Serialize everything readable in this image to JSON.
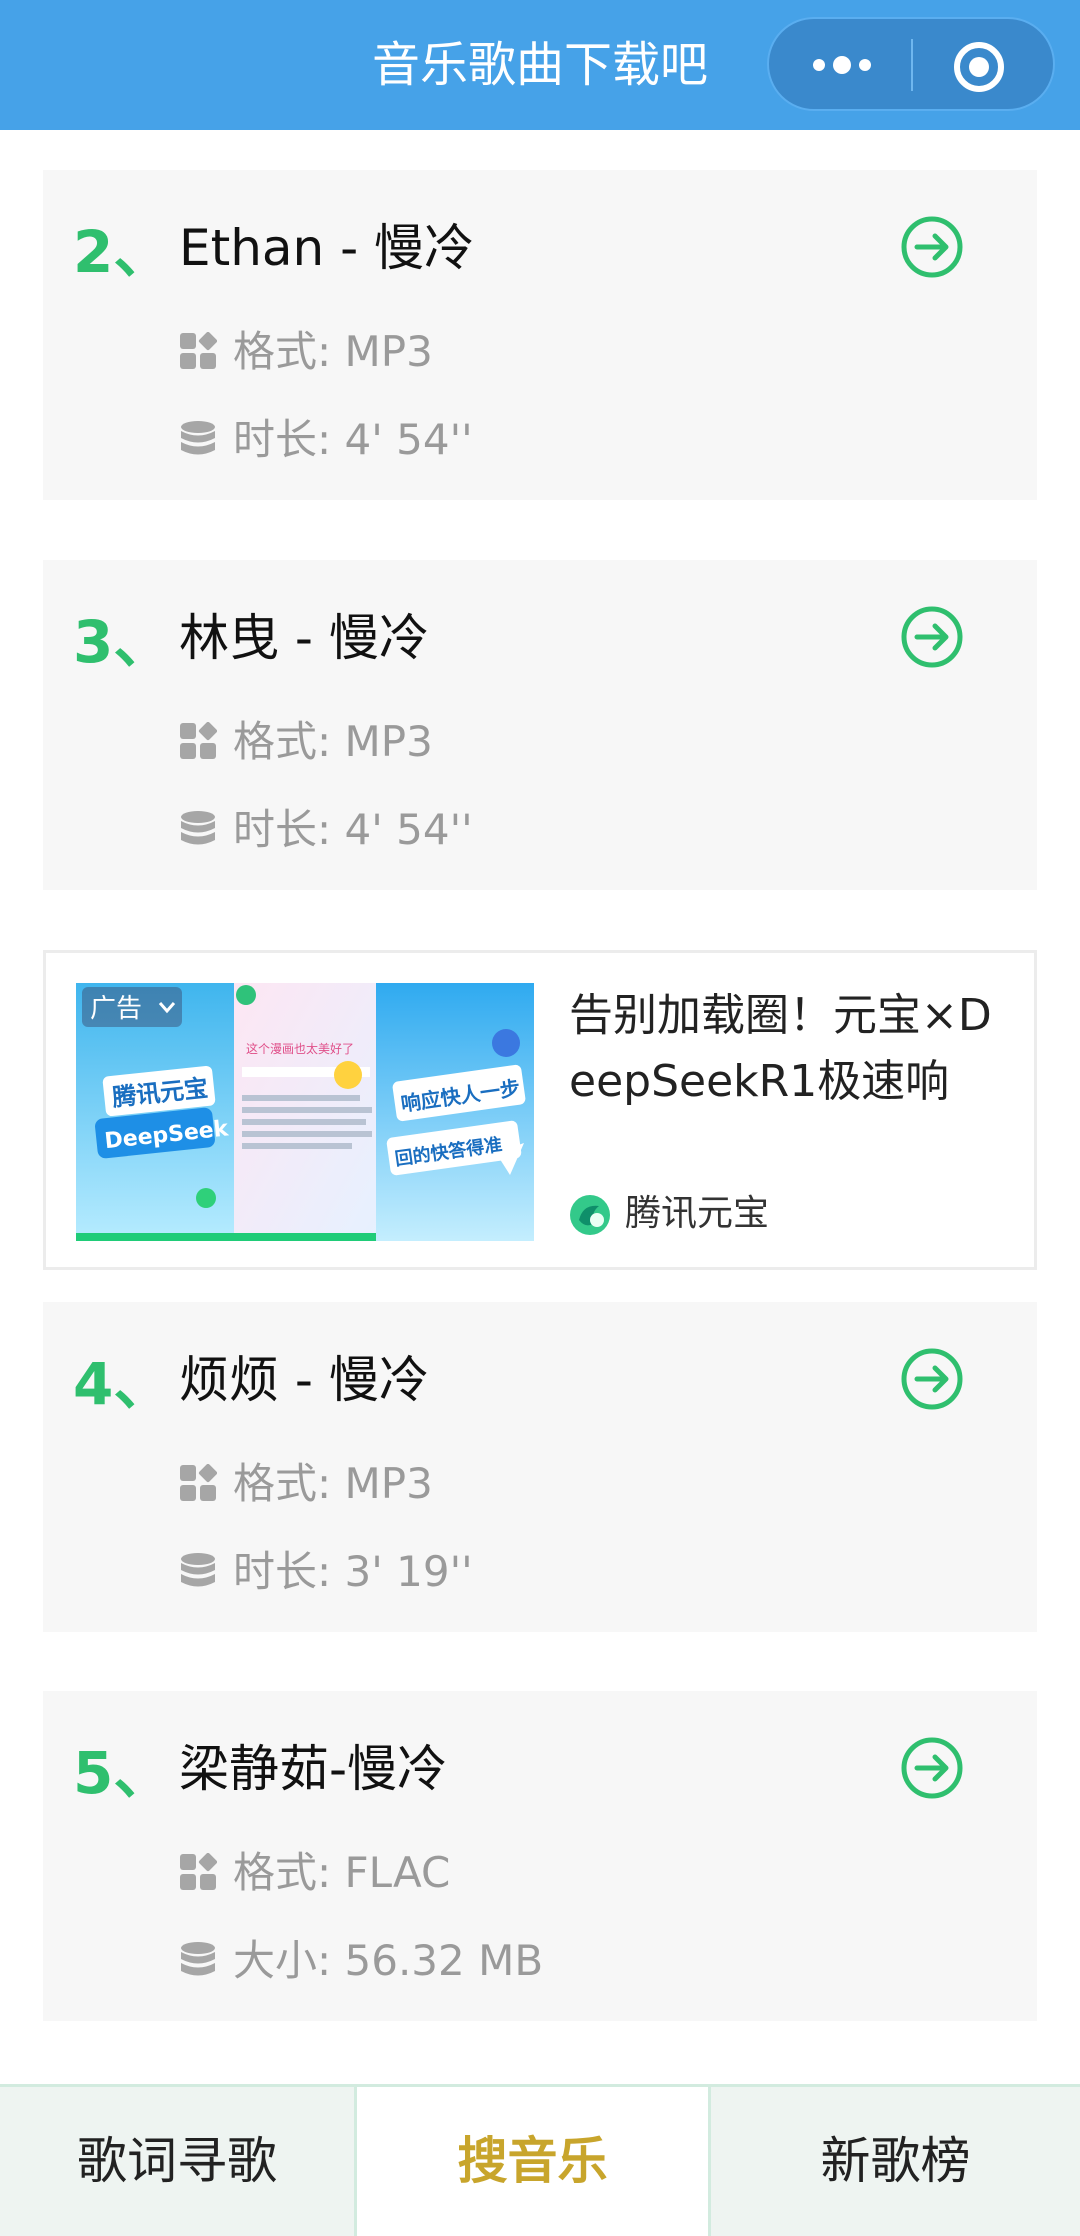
{
  "header": {
    "title": "音乐歌曲下载吧",
    "more_icon": "more-dots-icon",
    "close_icon": "target-close-icon",
    "background": "#46a2e8"
  },
  "songs": [
    {
      "number": "2、",
      "title": "Ethan - 慢冷",
      "format": "格式: MP3",
      "info": "时长: 4' 54''",
      "format_icon": "apps-grid-icon",
      "info_icon": "database-icon",
      "action_icon": "arrow-circle-right-icon"
    },
    {
      "number": "3、",
      "title": "林曳 - 慢冷",
      "format": "格式: MP3",
      "info": "时长: 4' 54''",
      "format_icon": "apps-grid-icon",
      "info_icon": "database-icon",
      "action_icon": "arrow-circle-right-icon"
    },
    {
      "number": "4、",
      "title": "烦烦 - 慢冷",
      "format": "格式: MP3",
      "info": "时长: 3' 19''",
      "format_icon": "apps-grid-icon",
      "info_icon": "database-icon",
      "action_icon": "arrow-circle-right-icon"
    },
    {
      "number": "5、",
      "title": "梁静茹-慢冷",
      "format": "格式: FLAC",
      "info": "大小: 56.32 MB",
      "format_icon": "apps-grid-icon",
      "info_icon": "database-icon",
      "action_icon": "arrow-circle-right-icon"
    }
  ],
  "ad": {
    "badge": "广告",
    "title": "告别加载圈！元宝×DeepSeekR1极速响",
    "brand": "腾讯元宝",
    "image_texts": {
      "left_top": "腾讯元宝",
      "left_bottom": "DeepSeek",
      "middle_caption": "这个漫画也太美好了",
      "right_top": "响应快人一步",
      "right_bottom": "回的快答得准"
    }
  },
  "tabs": [
    {
      "label": "歌词寻歌",
      "active": false
    },
    {
      "label": "搜音乐",
      "active": true
    },
    {
      "label": "新歌榜",
      "active": false
    }
  ],
  "colors": {
    "accent_green": "#2fbf6e",
    "active_tab": "#c8a52c"
  }
}
